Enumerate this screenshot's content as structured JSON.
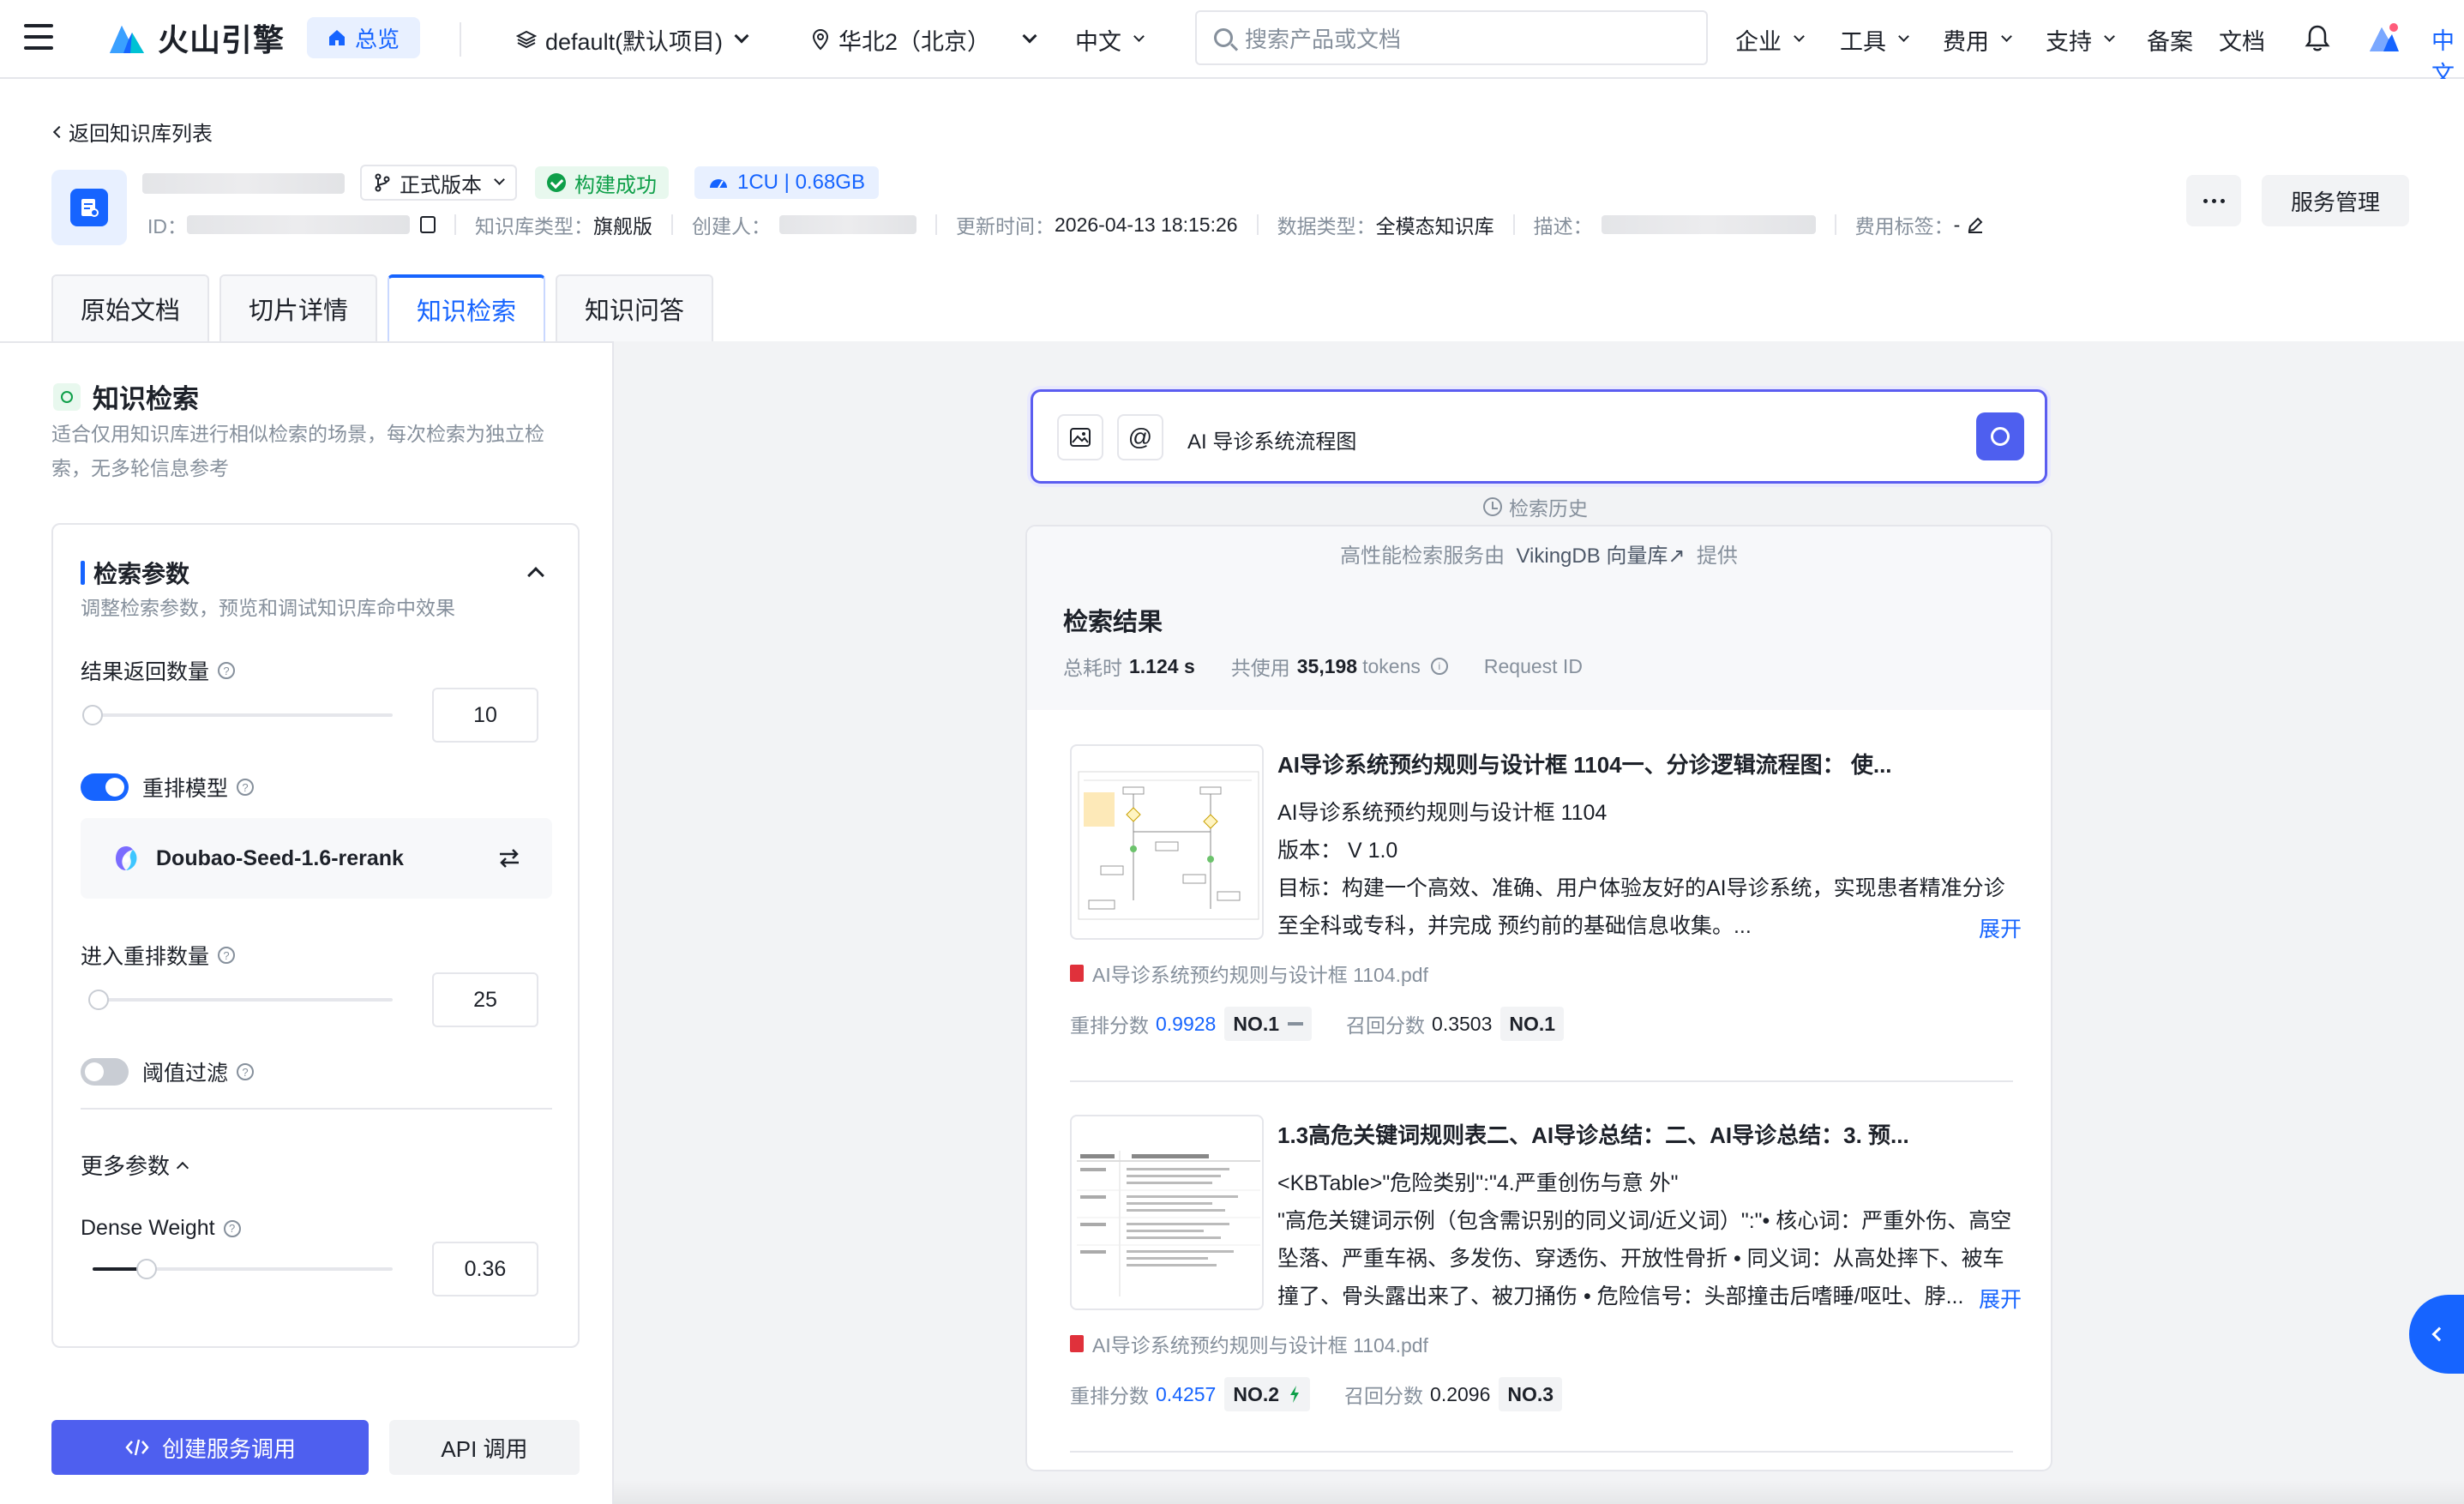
{
  "topbar": {
    "brand": "火山引擎",
    "home": "总览",
    "project": "default(默认项目)",
    "region": "华北2（北京）",
    "language": "中文",
    "search_placeholder": "搜索产品或文档",
    "menus": [
      "企业",
      "工具",
      "费用",
      "支持"
    ],
    "links": [
      "备案",
      "文档"
    ],
    "lang_edge": "中文"
  },
  "header": {
    "back": "返回知识库列表",
    "version": "正式版本",
    "status": "构建成功",
    "resource": "1CU | 0.68GB",
    "meta": {
      "id_label": "ID：",
      "type_label": "知识库类型：",
      "type_value": "旗舰版",
      "creator_label": "创建人：",
      "updated_label": "更新时间：",
      "updated_value": "2026-04-13 18:15:26",
      "data_type_label": "数据类型：",
      "data_type_value": "全模态知识库",
      "desc_label": "描述：",
      "cost_label": "费用标签：",
      "cost_value": "-"
    },
    "service_button": "服务管理",
    "tabs": [
      "原始文档",
      "切片详情",
      "知识检索",
      "知识问答"
    ]
  },
  "left": {
    "title": "知识检索",
    "description": "适合仅用知识库进行相似检索的场景，每次检索为独立检索，无多轮信息参考",
    "params": {
      "title": "检索参数",
      "description": "调整检索参数，预览和调试知识库命中效果",
      "result_count_label": "结果返回数量",
      "result_count": "10",
      "result_count_level": 0.0,
      "rerank_label": "重排模型",
      "rerank_on": true,
      "rerank_model": "Doubao-Seed-1.6-rerank",
      "rerank_count_label": "进入重排数量",
      "rerank_count": "25",
      "rerank_count_level": 0.02,
      "threshold_label": "阈值过滤",
      "threshold_on": false,
      "more_label": "更多参数",
      "dense_label": "Dense Weight",
      "dense_value": "0.36",
      "dense_level": 0.18
    },
    "create_button": "创建服务调用",
    "api_button": "API 调用"
  },
  "main": {
    "query": "AI 导诊系统流程图",
    "history": "检索历史",
    "provider_prefix": "高性能检索服务由",
    "provider_name": "VikingDB 向量库↗",
    "provider_suffix": "提供",
    "results_title": "检索结果",
    "stats": {
      "time_label": "总耗时",
      "time_value": "1.124 s",
      "tokens_label": "共使用",
      "tokens_value": "35,198",
      "tokens_unit": "tokens",
      "request_label": "Request ID"
    },
    "results": [
      {
        "title": "AI导诊系统预约规则与设计框 1104一、分诊逻辑流程图： 使...",
        "lines": [
          "AI导诊系统预约规则与设计框 1104",
          "版本： V 1.0",
          "目标：构建一个高效、准确、用户体验友好的AI导诊系统，实现患者精准分诊",
          "至全科或专科，并完成 预约前的基础信息收集。..."
        ],
        "expand": "展开",
        "file": "AI导诊系统预约规则与设计框 1104.pdf",
        "rerank_label": "重排分数",
        "rerank_score": "0.9928",
        "rerank_rank": "NO.1",
        "recall_label": "召回分数",
        "recall_score": "0.3503",
        "recall_rank": "NO.1"
      },
      {
        "title": "1.3高危关键词规则表二、AI导诊总结：二、AI导诊总结：3. 预...",
        "lines": [
          "<KBTable>\"危险类别\":\"4.严重创伤与意 外\"",
          "\"高危关键词示例（包含需识别的同义词/近义词）\":\"• 核心词：严重外伤、高空",
          "坠落、严重车祸、多发伤、穿透伤、开放性骨折 • 同义词：从高处摔下、被车",
          "撞了、骨头露出来了、被刀捅伤 • 危险信号：头部撞击后嗜睡/呕吐、脖..."
        ],
        "expand": "展开",
        "file": "AI导诊系统预约规则与设计框 1104.pdf",
        "rerank_label": "重排分数",
        "rerank_score": "0.4257",
        "rerank_rank": "NO.2",
        "recall_label": "召回分数",
        "recall_score": "0.2096",
        "recall_rank": "NO.3"
      }
    ]
  },
  "colors": {
    "primary": "#1664ff",
    "accent": "#4e5fef",
    "success": "#0e9f49",
    "pdf": "#e0313b"
  }
}
